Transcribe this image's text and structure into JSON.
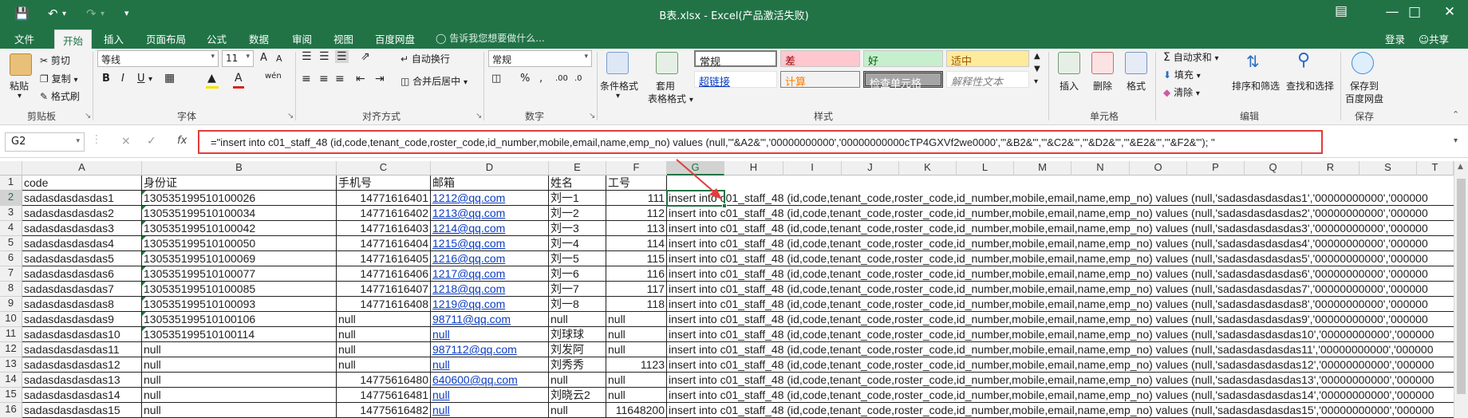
{
  "window": {
    "title": "B表.xlsx - Excel(产品激活失败)",
    "minimize_icon": "minimize-icon",
    "login": "登录",
    "share": "共享"
  },
  "tabs": [
    "文件",
    "开始",
    "插入",
    "页面布局",
    "公式",
    "数据",
    "审阅",
    "视图",
    "百度网盘"
  ],
  "active_tab": "开始",
  "tell_me": "告诉我您想要做什么...",
  "ribbon": {
    "clipboard": {
      "paste": "粘贴",
      "cut": "剪切",
      "copy": "复制",
      "format_painter": "格式刷",
      "label": "剪贴板"
    },
    "font": {
      "name": "等线",
      "size": "11",
      "bold": "B",
      "italic": "I",
      "underline": "U",
      "label": "字体",
      "grow": "A",
      "shrink": "A",
      "phonetic": "wén"
    },
    "alignment": {
      "wrap": "自动换行",
      "merge": "合并后居中",
      "label": "对齐方式"
    },
    "number": {
      "format": "常规",
      "percent": "%",
      "comma": ",",
      "label": "数字"
    },
    "styles": {
      "conditional": "条件格式",
      "table": "套用\n表格格式",
      "cells": [
        "常规",
        "差",
        "好",
        "适中",
        "超链接",
        "计算",
        "检查单元格",
        "解释性文本"
      ],
      "label": "样式"
    },
    "cells_group": {
      "insert": "插入",
      "delete": "删除",
      "format": "格式",
      "label": "单元格"
    },
    "editing": {
      "autosum": "自动求和",
      "fill": "填充",
      "clear": "清除",
      "sort": "排序和筛选",
      "find": "查找和选择",
      "label": "编辑"
    },
    "save": {
      "btn": "保存到\n百度网盘",
      "label": "保存"
    }
  },
  "formula_bar": {
    "name_box": "G2",
    "cancel": "×",
    "enter": "✓",
    "fx": "fx",
    "formula": "=\"insert into c01_staff_48 (id,code,tenant_code,roster_code,id_number,mobile,email,name,emp_no) values (null,'\"&A2&\"','00000000000','00000000000cTP4GXVf2we0000','\"&B2&\"','\"&C2&\"','\"&D2&\"','\"&E2&\"','\"&F2&\"'); \""
  },
  "columns": [
    "A",
    "B",
    "C",
    "D",
    "E",
    "F",
    "G",
    "H",
    "I",
    "J",
    "K",
    "L",
    "M",
    "N",
    "O",
    "P",
    "Q",
    "R",
    "S",
    "T"
  ],
  "selected_column": "G",
  "header_row": [
    "code",
    "身份证",
    "手机号",
    "邮箱",
    "姓名",
    "工号",
    ""
  ],
  "rows": [
    {
      "n": "2",
      "a": "sadasdasdasdas1",
      "b": "130535199510100026",
      "c": "14771616401",
      "d": "1212@qq.com",
      "e": "刘一1",
      "f": "111",
      "g": "insert into c01_staff_48 (id,code,tenant_code,roster_code,id_number,mobile,email,name,emp_no) values (null,'sadasdasdasdas1','00000000000','000000"
    },
    {
      "n": "3",
      "a": "sadasdasdasdas2",
      "b": "130535199510100034",
      "c": "14771616402",
      "d": "1213@qq.com",
      "e": "刘一2",
      "f": "112",
      "g": "insert into c01_staff_48 (id,code,tenant_code,roster_code,id_number,mobile,email,name,emp_no) values (null,'sadasdasdasdas2','00000000000','000000"
    },
    {
      "n": "4",
      "a": "sadasdasdasdas3",
      "b": "130535199510100042",
      "c": "14771616403",
      "d": "1214@qq.com",
      "e": "刘一3",
      "f": "113",
      "g": "insert into c01_staff_48 (id,code,tenant_code,roster_code,id_number,mobile,email,name,emp_no) values (null,'sadasdasdasdas3','00000000000','000000"
    },
    {
      "n": "5",
      "a": "sadasdasdasdas4",
      "b": "130535199510100050",
      "c": "14771616404",
      "d": "1215@qq.com",
      "e": "刘一4",
      "f": "114",
      "g": "insert into c01_staff_48 (id,code,tenant_code,roster_code,id_number,mobile,email,name,emp_no) values (null,'sadasdasdasdas4','00000000000','000000"
    },
    {
      "n": "6",
      "a": "sadasdasdasdas5",
      "b": "130535199510100069",
      "c": "14771616405",
      "d": "1216@qq.com",
      "e": "刘一5",
      "f": "115",
      "g": "insert into c01_staff_48 (id,code,tenant_code,roster_code,id_number,mobile,email,name,emp_no) values (null,'sadasdasdasdas5','00000000000','000000"
    },
    {
      "n": "7",
      "a": "sadasdasdasdas6",
      "b": "130535199510100077",
      "c": "14771616406",
      "d": "1217@qq.com",
      "e": "刘一6",
      "f": "116",
      "g": "insert into c01_staff_48 (id,code,tenant_code,roster_code,id_number,mobile,email,name,emp_no) values (null,'sadasdasdasdas6','00000000000','000000"
    },
    {
      "n": "8",
      "a": "sadasdasdasdas7",
      "b": "130535199510100085",
      "c": "14771616407",
      "d": "1218@qq.com",
      "e": "刘一7",
      "f": "117",
      "g": "insert into c01_staff_48 (id,code,tenant_code,roster_code,id_number,mobile,email,name,emp_no) values (null,'sadasdasdasdas7','00000000000','000000"
    },
    {
      "n": "9",
      "a": "sadasdasdasdas8",
      "b": "130535199510100093",
      "c": "14771616408",
      "d": "1219@qq.com",
      "e": "刘一8",
      "f": "118",
      "g": "insert into c01_staff_48 (id,code,tenant_code,roster_code,id_number,mobile,email,name,emp_no) values (null,'sadasdasdasdas8','00000000000','000000"
    },
    {
      "n": "10",
      "a": "sadasdasdasdas9",
      "b": "130535199510100106",
      "c": "null",
      "d": "98711@qq.com",
      "e": "null",
      "f": "null",
      "g": "insert into c01_staff_48 (id,code,tenant_code,roster_code,id_number,mobile,email,name,emp_no) values (null,'sadasdasdasdas9','00000000000','000000"
    },
    {
      "n": "11",
      "a": "sadasdasdasdas10",
      "b": "130535199510100114",
      "c": "null",
      "d": "null",
      "e": "刘球球",
      "f": "null",
      "g": "insert into c01_staff_48 (id,code,tenant_code,roster_code,id_number,mobile,email,name,emp_no) values (null,'sadasdasdasdas10','00000000000','000000"
    },
    {
      "n": "12",
      "a": "sadasdasdasdas11",
      "b": "null",
      "c": "null",
      "d": "987112@qq.com",
      "e": "刘发阿",
      "f": "null",
      "g": "insert into c01_staff_48 (id,code,tenant_code,roster_code,id_number,mobile,email,name,emp_no) values (null,'sadasdasdasdas11','00000000000','000000"
    },
    {
      "n": "13",
      "a": "sadasdasdasdas12",
      "b": "null",
      "c": "null",
      "d": "null",
      "e": "刘秀秀",
      "f": "1123",
      "g": "insert into c01_staff_48 (id,code,tenant_code,roster_code,id_number,mobile,email,name,emp_no) values (null,'sadasdasdasdas12','00000000000','000000"
    },
    {
      "n": "14",
      "a": "sadasdasdasdas13",
      "b": "null",
      "c": "14775616480",
      "d": "640600@qq.com",
      "e": "null",
      "f": "null",
      "g": "insert into c01_staff_48 (id,code,tenant_code,roster_code,id_number,mobile,email,name,emp_no) values (null,'sadasdasdasdas13','00000000000','000000"
    },
    {
      "n": "15",
      "a": "sadasdasdasdas14",
      "b": "null",
      "c": "14775616481",
      "d": "null",
      "e": "刘晓云2",
      "f": "null",
      "g": "insert into c01_staff_48 (id,code,tenant_code,roster_code,id_number,mobile,email,name,emp_no) values (null,'sadasdasdasdas14','00000000000','000000"
    },
    {
      "n": "16",
      "a": "sadasdasdasdas15",
      "b": "null",
      "c": "14775616482",
      "d": "null",
      "e": "null",
      "f": "11648200",
      "g": "insert into c01_staff_48 (id,code,tenant_code,roster_code,id_number,mobile,email,name,emp_no) values (null,'sadasdasdasdas15','00000000000','000000"
    }
  ],
  "colors": {
    "accent": "#217346",
    "highlight": "#e23c3c",
    "link": "#0b3cc2"
  }
}
